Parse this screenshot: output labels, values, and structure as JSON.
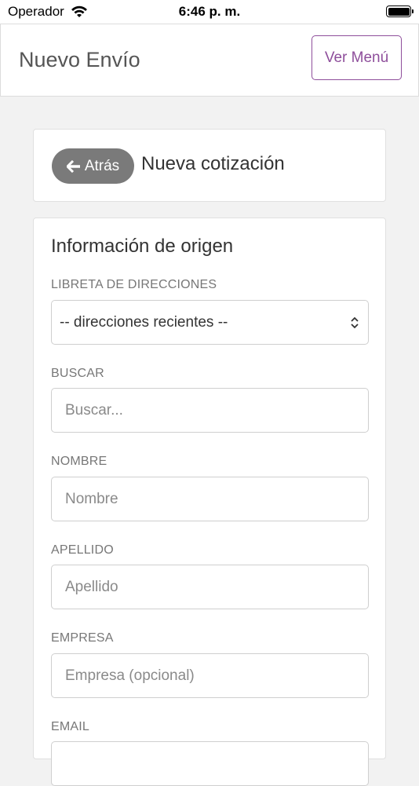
{
  "status_bar": {
    "carrier": "Operador",
    "time": "6:46 p. m."
  },
  "header": {
    "title": "Nuevo Envío",
    "menu_label": "Ver Menú"
  },
  "quote_card": {
    "back_label": "Atrás",
    "title": "Nueva cotización"
  },
  "origin_form": {
    "title": "Información de origen",
    "address_book": {
      "label": "LIBRETA DE DIRECCIONES",
      "value": "-- direcciones recientes --"
    },
    "search": {
      "label": "BUSCAR",
      "placeholder": "Buscar..."
    },
    "first_name": {
      "label": "NOMBRE",
      "placeholder": "Nombre"
    },
    "last_name": {
      "label": "APELLIDO",
      "placeholder": "Apellido"
    },
    "company": {
      "label": "EMPRESA",
      "placeholder": "Empresa (opcional)"
    },
    "email": {
      "label": "EMAIL"
    }
  },
  "colors": {
    "accent": "#8e4e9b",
    "back_button": "#7a7a7a",
    "background": "#f2f2f2"
  }
}
